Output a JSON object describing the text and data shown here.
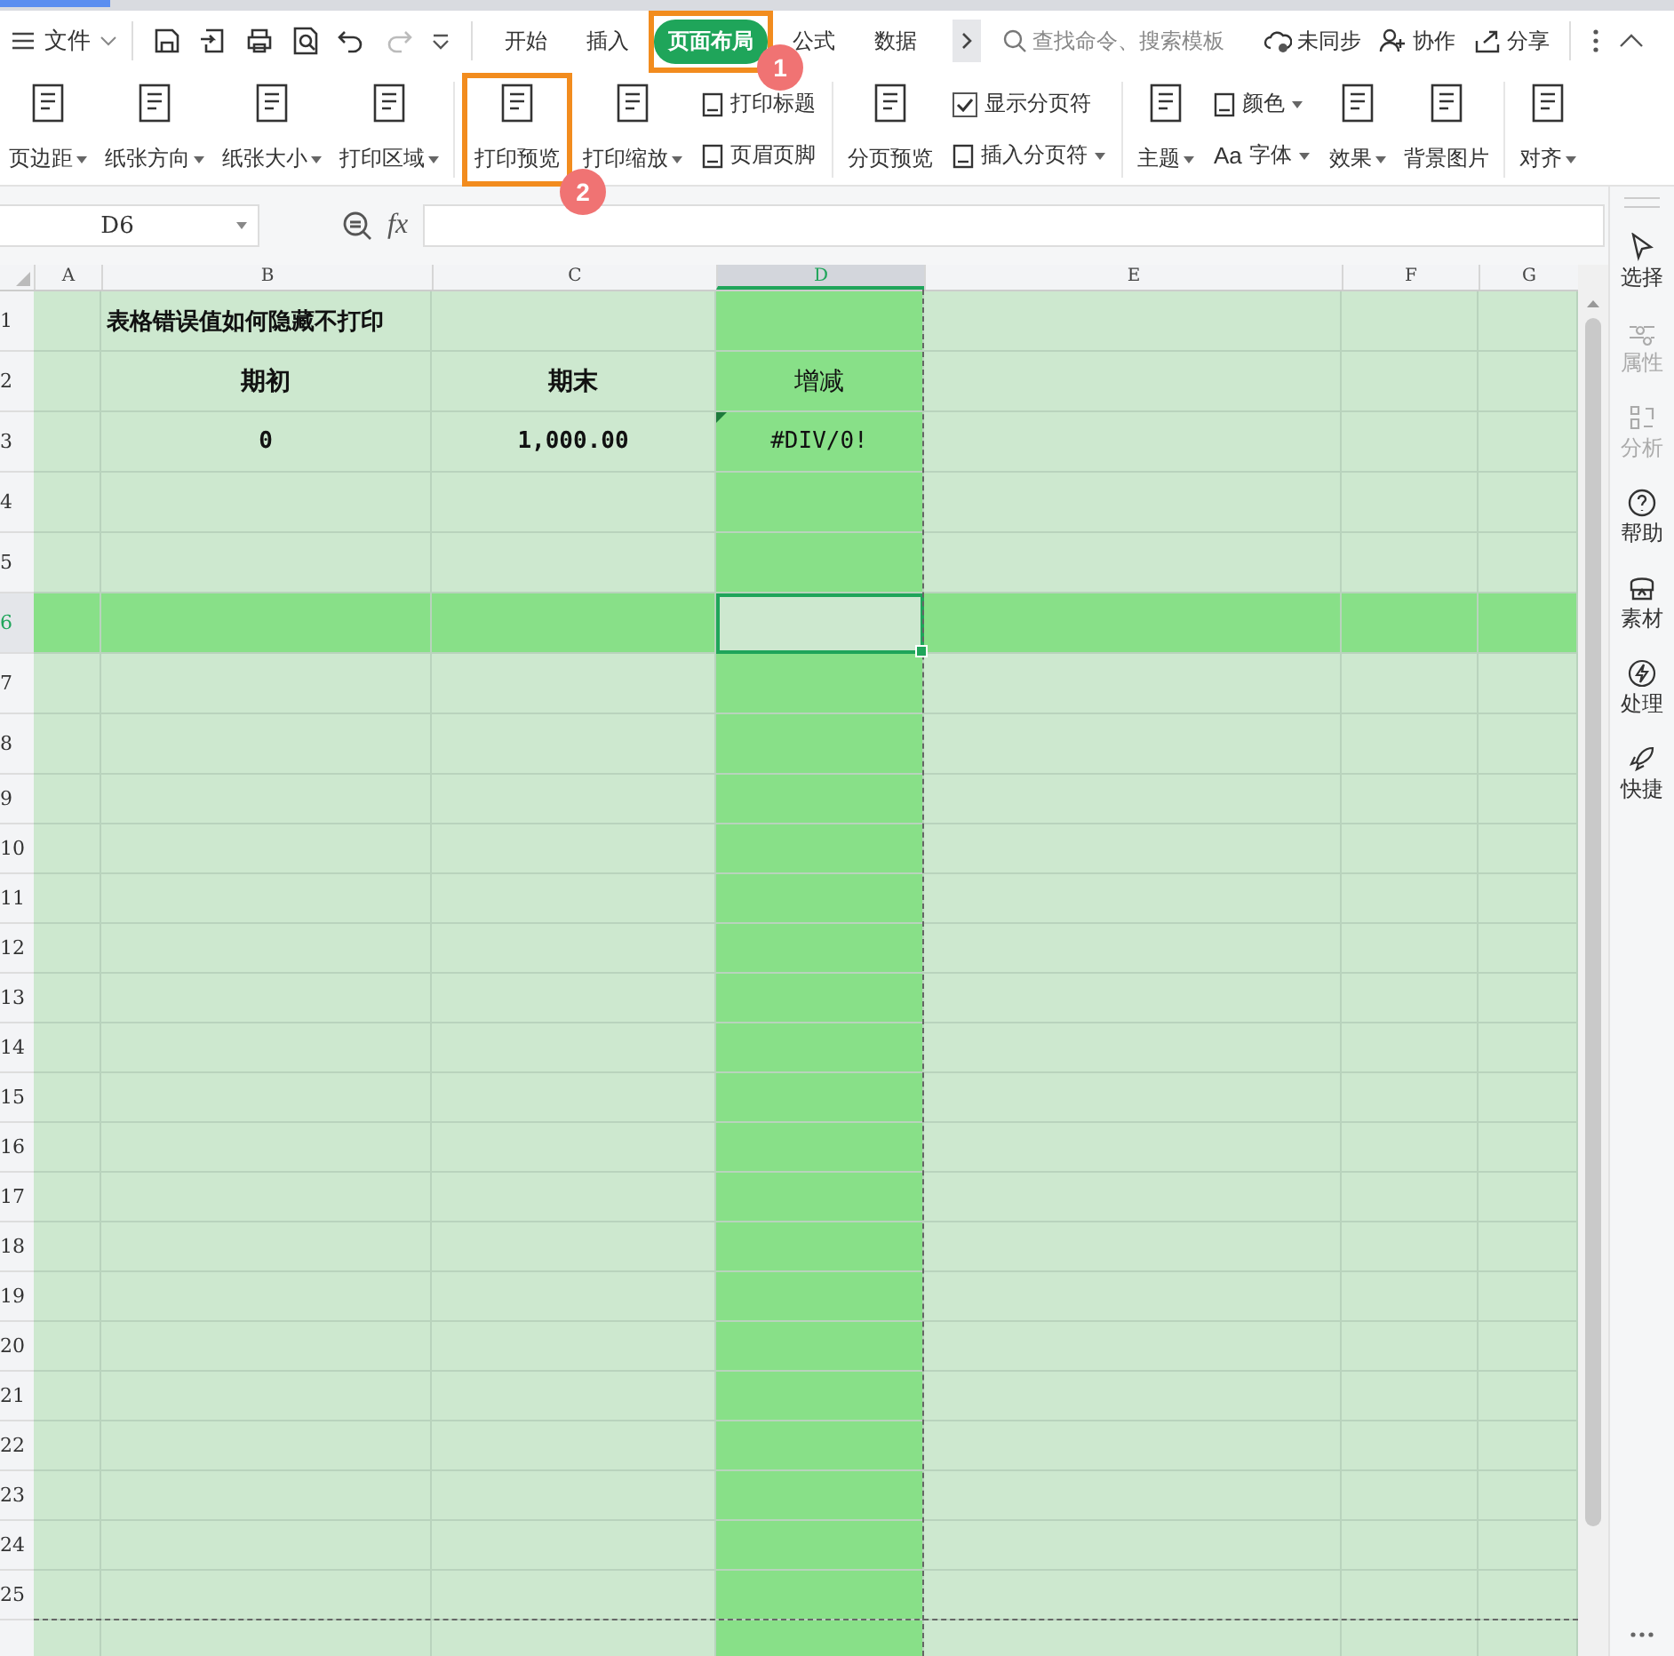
{
  "menu": {
    "file_label": "文件"
  },
  "tabs": [
    {
      "label": "开始",
      "selected": false
    },
    {
      "label": "插入",
      "selected": false
    },
    {
      "label": "页面布局",
      "selected": true,
      "callout": "1"
    },
    {
      "label": "公式",
      "selected": false
    },
    {
      "label": "数据",
      "selected": false
    }
  ],
  "search": {
    "placeholder": "查找命令、搜索模板"
  },
  "header_actions": [
    {
      "label": "未同步",
      "kind": "cloud"
    },
    {
      "label": "协作",
      "kind": "user"
    },
    {
      "label": "分享",
      "kind": "share"
    }
  ],
  "ribbon": [
    {
      "items": [
        {
          "kind": "large",
          "label": "页边距",
          "dropdown": true
        },
        {
          "kind": "large",
          "label": "纸张方向",
          "dropdown": true
        },
        {
          "kind": "large",
          "label": "纸张大小",
          "dropdown": true
        },
        {
          "kind": "large",
          "label": "打印区域",
          "dropdown": true
        }
      ]
    },
    {
      "items": [
        {
          "kind": "large",
          "label": "打印预览",
          "dropdown": false,
          "callout": "2"
        },
        {
          "kind": "large",
          "label": "打印缩放",
          "dropdown": true
        },
        {
          "kind": "stack",
          "rows": [
            {
              "kind": "button",
              "label": "打印标题",
              "dropdown": false
            },
            {
              "kind": "button",
              "label": "页眉页脚",
              "dropdown": false
            }
          ]
        }
      ]
    },
    {
      "items": [
        {
          "kind": "large",
          "label": "分页预览",
          "dropdown": false
        },
        {
          "kind": "stack",
          "rows": [
            {
              "kind": "checkbox",
              "label": "显示分页符",
              "checked": true
            },
            {
              "kind": "button",
              "label": "插入分页符",
              "dropdown": true
            }
          ]
        }
      ]
    },
    {
      "items": [
        {
          "kind": "large",
          "label": "主题",
          "dropdown": true
        },
        {
          "kind": "stack",
          "rows": [
            {
              "kind": "button",
              "label": "颜色",
              "dropdown": true
            },
            {
              "kind": "button",
              "label": "字体",
              "prefix": "Aa",
              "dropdown": true
            }
          ]
        },
        {
          "kind": "large",
          "label": "效果",
          "dropdown": true
        },
        {
          "kind": "large",
          "label": "背景图片",
          "dropdown": false
        }
      ]
    },
    {
      "items": [
        {
          "kind": "large",
          "label": "对齐",
          "dropdown": true
        }
      ]
    }
  ],
  "formula_bar": {
    "name_box": "D6",
    "fx": "fx"
  },
  "columns": [
    {
      "label": "A",
      "selected": false
    },
    {
      "label": "B",
      "selected": false
    },
    {
      "label": "C",
      "selected": false
    },
    {
      "label": "D",
      "selected": true
    },
    {
      "label": "E",
      "selected": false
    },
    {
      "label": "F",
      "selected": false
    },
    {
      "label": "G",
      "selected": false
    }
  ],
  "rows": [
    {
      "label": "1",
      "selected": false,
      "cells": [
        null,
        {
          "text": "表格错误值如何隐藏不打印",
          "bold": true,
          "kind": "title"
        },
        null,
        null,
        null,
        null,
        null
      ]
    },
    {
      "label": "2",
      "selected": false,
      "cells": [
        null,
        {
          "text": "期初",
          "bold": true,
          "kind": "value"
        },
        {
          "text": "期末",
          "bold": true,
          "kind": "value"
        },
        {
          "text": "增减",
          "bold": false,
          "kind": "value"
        },
        null,
        null,
        null
      ]
    },
    {
      "label": "3",
      "selected": false,
      "cells": [
        null,
        {
          "text": "0",
          "bold": true,
          "kind": "number"
        },
        {
          "text": "1,000.00",
          "bold": true,
          "kind": "number"
        },
        {
          "text": "#DIV/0!",
          "bold": false,
          "kind": "number",
          "error_flag": true
        },
        null,
        null,
        null
      ]
    },
    {
      "label": "4",
      "selected": false
    },
    {
      "label": "5",
      "selected": false
    },
    {
      "label": "6",
      "selected": true
    },
    {
      "label": "7",
      "selected": false
    },
    {
      "label": "8",
      "selected": false
    },
    {
      "label": "9",
      "selected": false
    },
    {
      "label": "10",
      "selected": false
    },
    {
      "label": "11",
      "selected": false
    },
    {
      "label": "12",
      "selected": false
    },
    {
      "label": "13",
      "selected": false
    },
    {
      "label": "14",
      "selected": false
    },
    {
      "label": "15",
      "selected": false
    },
    {
      "label": "16",
      "selected": false
    },
    {
      "label": "17",
      "selected": false
    },
    {
      "label": "18",
      "selected": false
    },
    {
      "label": "19",
      "selected": false
    },
    {
      "label": "20",
      "selected": false
    },
    {
      "label": "21",
      "selected": false
    },
    {
      "label": "22",
      "selected": false
    },
    {
      "label": "23",
      "selected": false
    },
    {
      "label": "24",
      "selected": false
    },
    {
      "label": "25",
      "selected": false
    }
  ],
  "side_panel": [
    {
      "label": "选择",
      "disabled": false,
      "kind": "cursor"
    },
    {
      "label": "属性",
      "disabled": true,
      "kind": "sliders"
    },
    {
      "label": "分析",
      "disabled": true,
      "kind": "analyze"
    },
    {
      "label": "帮助",
      "disabled": false,
      "kind": "help"
    },
    {
      "label": "素材",
      "disabled": false,
      "kind": "assets"
    },
    {
      "label": "处理",
      "disabled": false,
      "kind": "bolt"
    },
    {
      "label": "快捷",
      "disabled": false,
      "kind": "rocket"
    }
  ]
}
